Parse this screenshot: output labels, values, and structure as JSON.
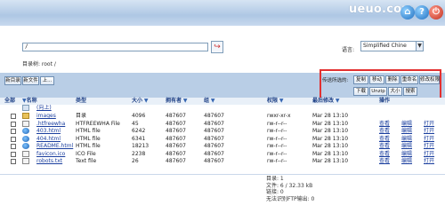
{
  "header": {
    "brand": "ueuo.com",
    "icons": [
      "home-icon",
      "help-icon",
      "exit-icon"
    ]
  },
  "path": {
    "value": "/",
    "go_icon": "go-arrow-icon"
  },
  "directory_info": "目录树: root /",
  "language": {
    "label": "语言:",
    "selected": "Simplified Chine"
  },
  "toolbar": {
    "left_buttons": [
      "新目录",
      "新文件",
      "上..."
    ],
    "selected_label": "传送所选的:",
    "row1_buttons": [
      "复制",
      "移动",
      "删除",
      "重命名",
      "修改权限"
    ],
    "row2_buttons": [
      "下载",
      "Unzip",
      "大小",
      "搜索"
    ]
  },
  "table": {
    "headers": {
      "all": "全部",
      "name": "名称",
      "type": "类型",
      "size": "大小",
      "owner": "拥有者",
      "group": "组",
      "perms": "权限",
      "modified": "最后修改",
      "actions": "操作"
    },
    "parent_label": "(向上)",
    "rows": [
      {
        "name": "images",
        "type": "目录",
        "size": "4096",
        "owner": "487607",
        "group": "487607",
        "perms": "rwxr-xr-x",
        "modified": "Mar 28 13:10",
        "actions": []
      },
      {
        "name": ".htfreewha",
        "type": "HTFREEWHA File",
        "size": "45",
        "owner": "487607",
        "group": "487607",
        "perms": "rw-r--r--",
        "modified": "Mar 28 13:10",
        "actions": [
          "查看",
          "编辑",
          "打开"
        ]
      },
      {
        "name": "403.html",
        "type": "HTML file",
        "size": "6242",
        "owner": "487607",
        "group": "487607",
        "perms": "rw-r--r--",
        "modified": "Mar 28 13:10",
        "actions": [
          "查看",
          "编辑",
          "打开"
        ]
      },
      {
        "name": "404.html",
        "type": "HTML file",
        "size": "6341",
        "owner": "487607",
        "group": "487607",
        "perms": "rw-r--r--",
        "modified": "Mar 28 13:10",
        "actions": [
          "查看",
          "编辑",
          "打开"
        ]
      },
      {
        "name": "README.html",
        "type": "HTML file",
        "size": "18213",
        "owner": "487607",
        "group": "487607",
        "perms": "rw-r--r--",
        "modified": "Mar 28 13:10",
        "actions": [
          "查看",
          "编辑",
          "打开"
        ]
      },
      {
        "name": "favicon.ico",
        "type": "ICO File",
        "size": "2238",
        "owner": "487607",
        "group": "487607",
        "perms": "rw-r--r--",
        "modified": "Mar 28 13:10",
        "actions": [
          "查看",
          "编辑",
          "打开"
        ]
      },
      {
        "name": "robots.txt",
        "type": "Text file",
        "size": "26",
        "owner": "487607",
        "group": "487607",
        "perms": "rw-r--r--",
        "modified": "Mar 28 13:10",
        "actions": [
          "查看",
          "编辑",
          "打开"
        ]
      }
    ]
  },
  "stats": {
    "dirs": "目录: 1",
    "files": "文件: 6 / 32.33 kB",
    "symlinks": "链接: 0",
    "unreadable": "无法识别FTP输出: 0"
  },
  "colors": {
    "header_bg": "#aec7e4",
    "toolbar_bg": "#b9cee6",
    "highlight_box": "#e23030",
    "link": "#1a3e9e"
  }
}
